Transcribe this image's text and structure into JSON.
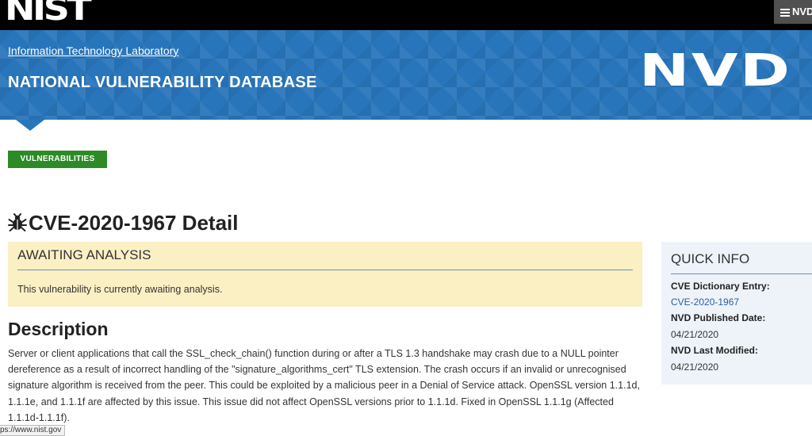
{
  "brand": {
    "nist": "NIST",
    "nvd_logo": "NVD",
    "menu_label": "NVD"
  },
  "header": {
    "itl_link": "Information Technology Laboratory",
    "title": "NATIONAL VULNERABILITY DATABASE"
  },
  "nav": {
    "vulnerabilities_button": "VULNERABILITIES"
  },
  "cve": {
    "title": "CVE-2020-1967 Detail"
  },
  "status_panel": {
    "heading": "AWAITING ANALYSIS",
    "body": "This vulnerability is currently awaiting analysis."
  },
  "description": {
    "heading": "Description",
    "text": "Server or client applications that call the SSL_check_chain() function during or after a TLS 1.3 handshake may crash due to a NULL pointer dereference as a result of incorrect handling of the \"signature_algorithms_cert\" TLS extension. The crash occurs if an invalid or unrecognised signature algorithm is received from the peer. This could be exploited by a malicious peer in a Denial of Service attack. OpenSSL version 1.1.1d, 1.1.1e, and 1.1.1f are affected by this issue. This issue did not affect OpenSSL versions prior to 1.1.1d. Fixed in OpenSSL 1.1.1g (Affected 1.1.1d-1.1.1f)."
  },
  "quick_info": {
    "heading": "QUICK INFO",
    "cve_entry_label": "CVE Dictionary Entry:",
    "cve_entry_value": "CVE-2020-1967",
    "published_label": "NVD Published Date:",
    "published_value": "04/21/2020",
    "modified_label": "NVD Last Modified:",
    "modified_value": "04/21/2020"
  },
  "status_bar": {
    "url": "ps://www.nist.gov"
  },
  "colors": {
    "header_blue": "#2875bb",
    "button_green": "#2d8b27",
    "notice_yellow": "#fbf0c4",
    "link_blue": "#2c5f9e"
  },
  "icons": {
    "menu": "hamburger-icon",
    "bug": "bug-icon"
  }
}
